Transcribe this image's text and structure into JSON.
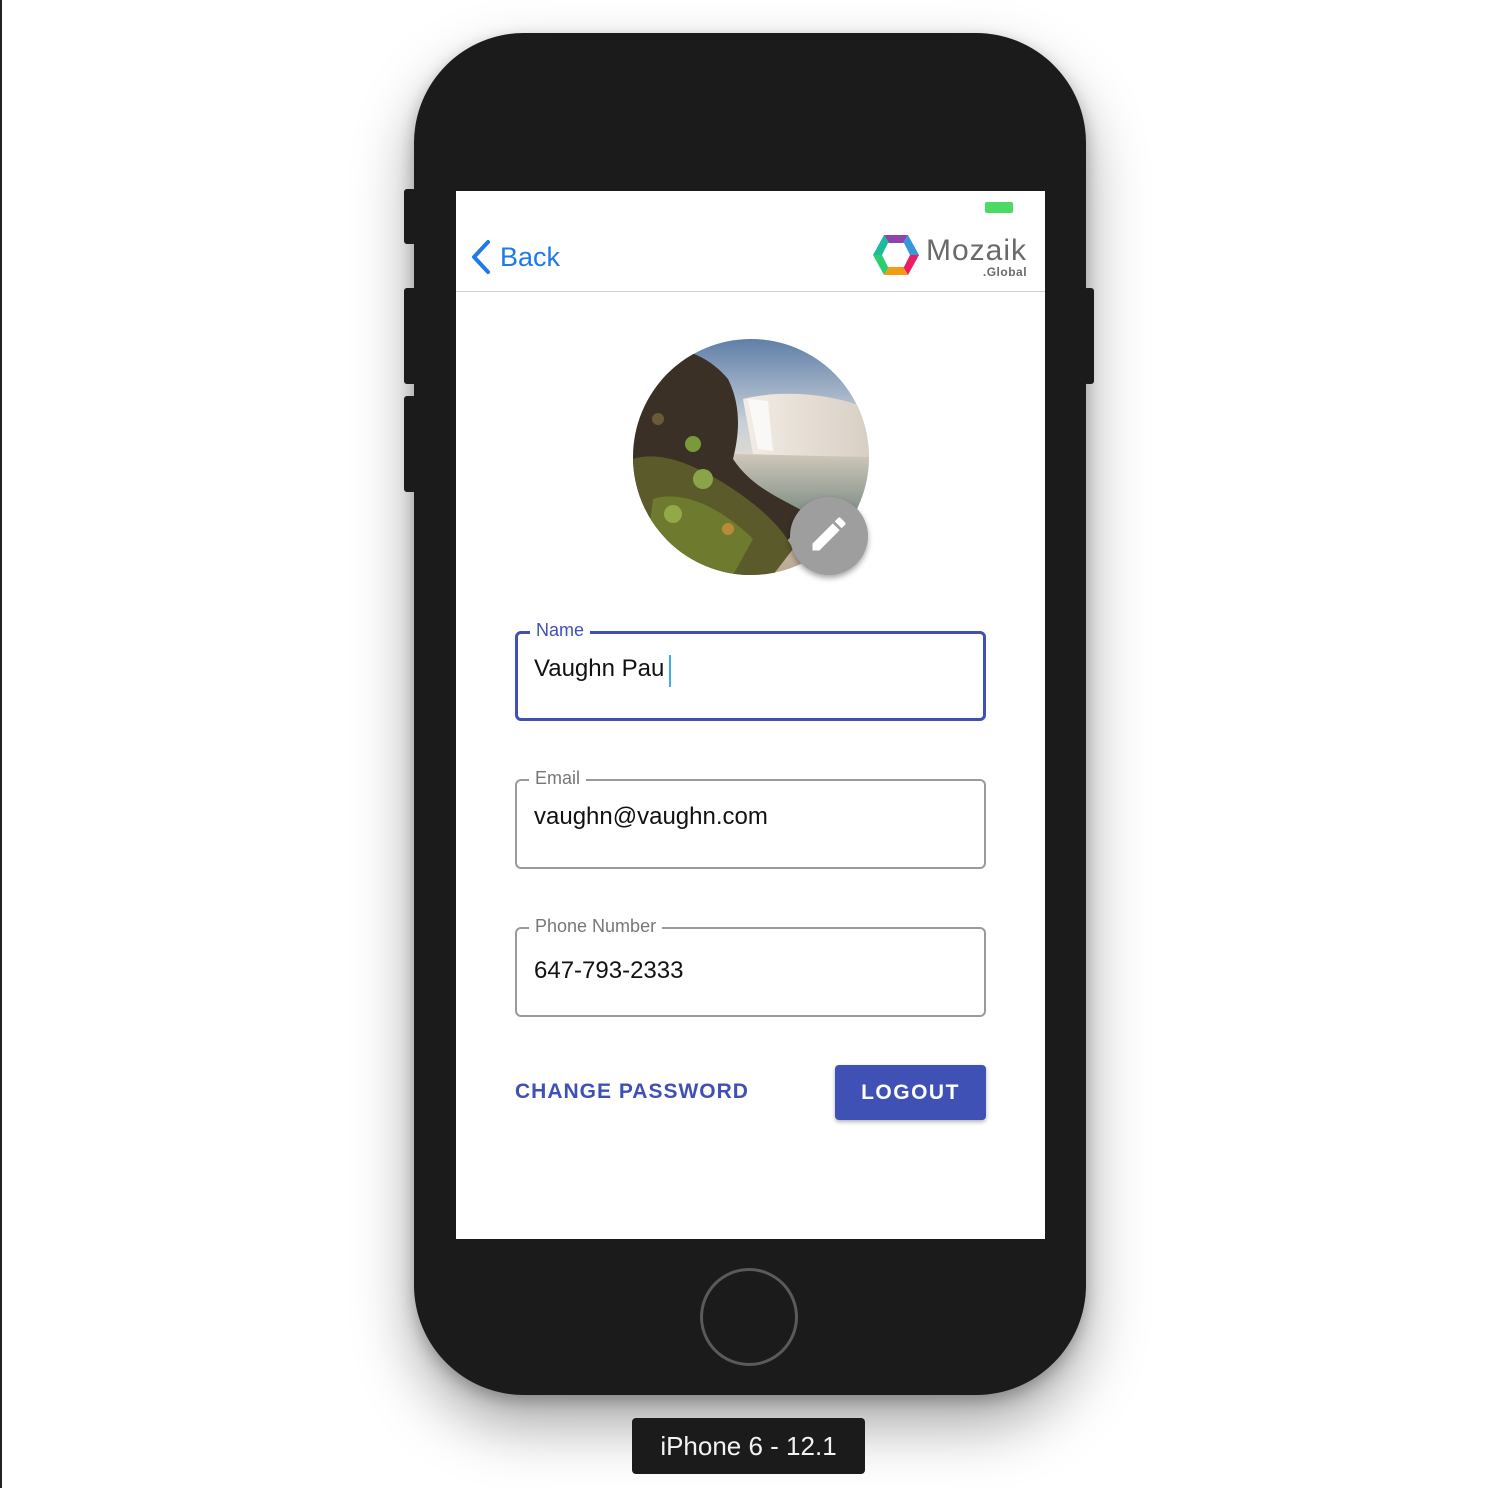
{
  "device_label": "iPhone 6 - 12.1",
  "nav": {
    "back_label": "Back",
    "logo_main": "Mozaik",
    "logo_sub": ".Global"
  },
  "form": {
    "name": {
      "label": "Name",
      "value": "Vaughn Pau"
    },
    "email": {
      "label": "Email",
      "value": "vaughn@vaughn.com"
    },
    "phone": {
      "label": "Phone Number",
      "value": "647-793-2333"
    }
  },
  "actions": {
    "change_password": "CHANGE PASSWORD",
    "logout": "LOGOUT"
  },
  "colors": {
    "primary": "#3f51b5",
    "ios_blue": "#1f7ae8",
    "battery": "#4cd964",
    "device": "#1b1b1b"
  },
  "icons": {
    "back": "chevron-left-icon",
    "edit": "pencil-icon",
    "logo": "mozaik-hexagon-logo"
  }
}
